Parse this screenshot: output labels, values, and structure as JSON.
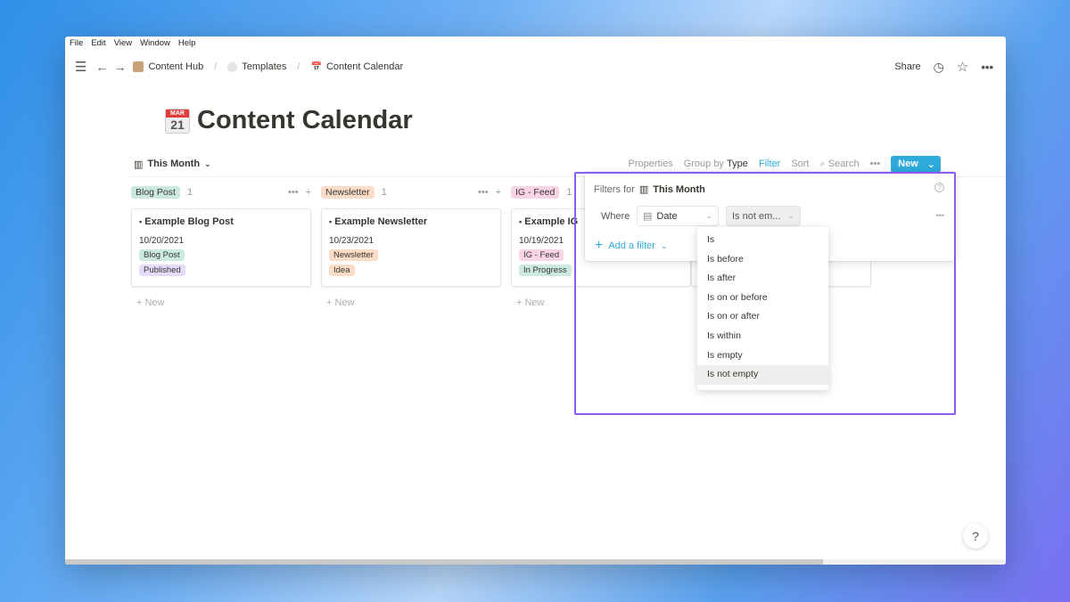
{
  "menu": [
    "File",
    "Edit",
    "View",
    "Window",
    "Help"
  ],
  "breadcrumb": [
    "Content Hub",
    "Templates",
    "Content Calendar"
  ],
  "topbar": {
    "share": "Share"
  },
  "page": {
    "title": "Content Calendar",
    "icon_text": "21"
  },
  "view": {
    "name": "This Month",
    "properties": "Properties",
    "group_by": "Group by",
    "group_value": "Type",
    "filter": "Filter",
    "sort": "Sort",
    "search": "Search",
    "new": "New"
  },
  "columns": [
    {
      "name": "Blog Post",
      "count": "1",
      "color": "#cce9e1",
      "card": {
        "title": "Example Blog Post",
        "date": "10/20/2021",
        "tags": [
          {
            "label": "Blog Post",
            "color": "#cce9e1"
          },
          {
            "label": "Published",
            "color": "#e6dbf8"
          }
        ]
      }
    },
    {
      "name": "Newsletter",
      "count": "1",
      "color": "#fbdcc6",
      "card": {
        "title": "Example Newsletter",
        "date": "10/23/2021",
        "tags": [
          {
            "label": "Newsletter",
            "color": "#fbdcc6"
          },
          {
            "label": "Idea",
            "color": "#fbdcc6"
          }
        ]
      }
    },
    {
      "name": "IG - Feed",
      "count": "1",
      "color": "#f9d3e6",
      "card": {
        "title": "Example IG",
        "date": "10/19/2021",
        "tags": [
          {
            "label": "IG - Feed",
            "color": "#f9d3e6"
          },
          {
            "label": "In Progress",
            "color": "#cce9e1"
          }
        ]
      }
    }
  ],
  "new_label": "New",
  "filter_popup": {
    "title": "Filters for",
    "view": "This Month",
    "where": "Where",
    "property": "Date",
    "operator": "Is not em...",
    "add": "Add a filter"
  },
  "operator_options": [
    "Is",
    "Is before",
    "Is after",
    "Is on or before",
    "Is on or after",
    "Is within",
    "Is empty",
    "Is not empty"
  ],
  "selected_option": "Is not empty",
  "help": "?"
}
